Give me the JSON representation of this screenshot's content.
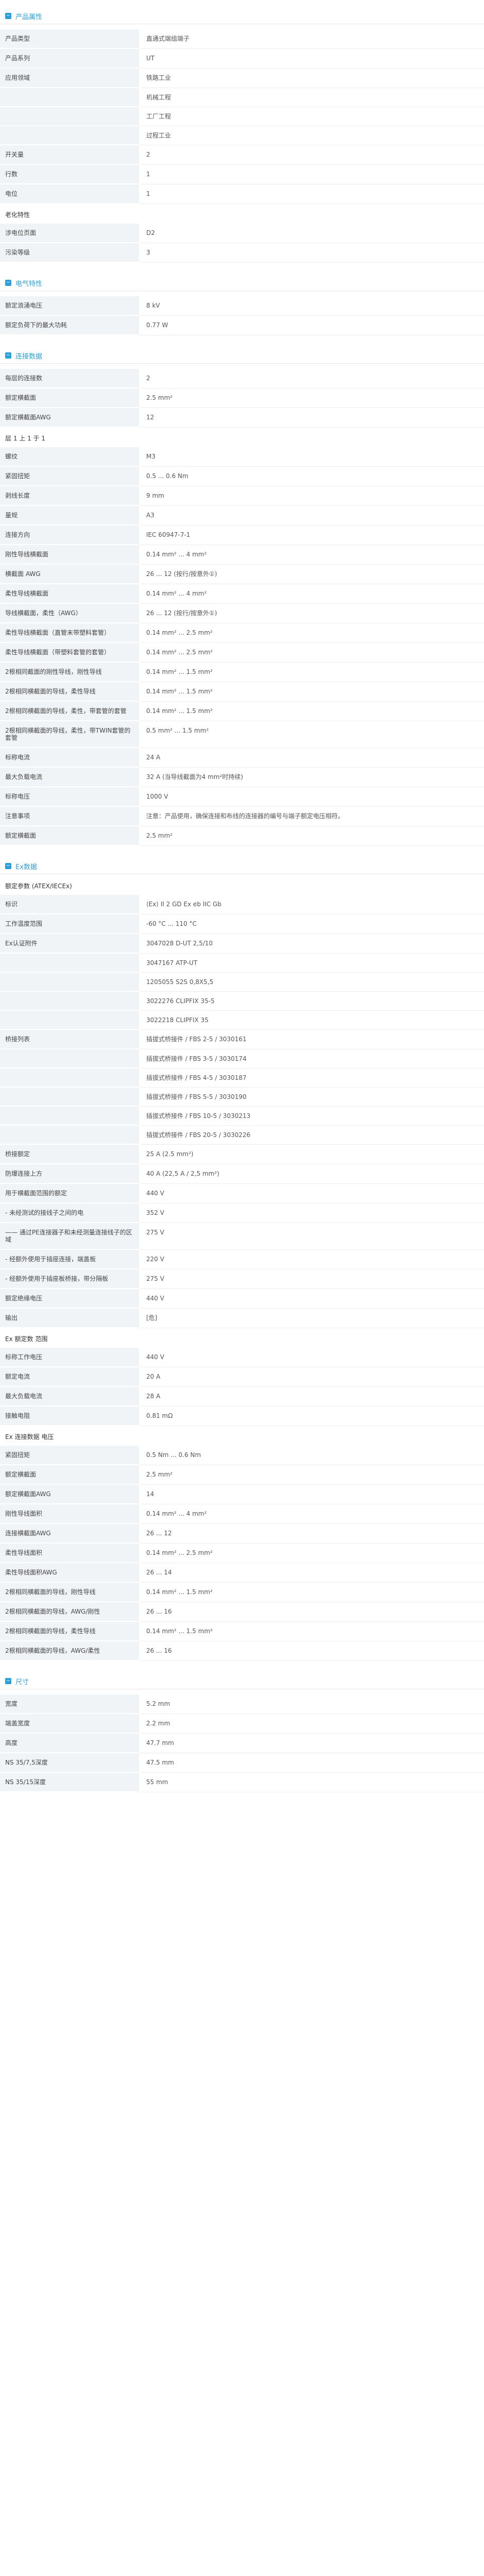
{
  "sections": [
    {
      "title": "产品属性",
      "groups": [
        {
          "rows": [
            {
              "key": "产品类型",
              "values": [
                "直通式端组端子"
              ]
            },
            {
              "key": "产品系列",
              "values": [
                "UT"
              ]
            },
            {
              "key": "应用领域",
              "values": [
                "铁路工业",
                "机械工程",
                "工厂工程",
                "过程工业"
              ]
            },
            {
              "key": "开关量",
              "values": [
                "2"
              ]
            },
            {
              "key": "行数",
              "values": [
                "1"
              ]
            },
            {
              "key": "电位",
              "values": [
                "1"
              ]
            }
          ]
        },
        {
          "subtitle": "老化特性",
          "rows": [
            {
              "key": "涉电位页面",
              "values": [
                "D2"
              ]
            },
            {
              "key": "污染等级",
              "values": [
                "3"
              ]
            }
          ]
        }
      ]
    },
    {
      "title": "电气特性",
      "groups": [
        {
          "rows": [
            {
              "key": "额定浪涌电压",
              "values": [
                "8 kV"
              ]
            },
            {
              "key": "额定负荷下的最大功耗",
              "values": [
                "0.77 W"
              ]
            }
          ]
        }
      ]
    },
    {
      "title": "连接数据",
      "groups": [
        {
          "rows": [
            {
              "key": "每层的连接数",
              "values": [
                "2"
              ]
            },
            {
              "key": "额定横截面",
              "values": [
                "2.5 mm²"
              ]
            },
            {
              "key": "额定横截面AWG",
              "values": [
                "12"
              ]
            }
          ]
        },
        {
          "subtitle": "层 1 上 1 于 1",
          "rows": [
            {
              "key": "螺纹",
              "values": [
                "M3"
              ]
            },
            {
              "key": "紧固扭矩",
              "values": [
                "0.5 ... 0.6 Nm"
              ]
            },
            {
              "key": "剥线长度",
              "values": [
                "9 mm"
              ]
            },
            {
              "key": "量规",
              "values": [
                "A3"
              ]
            },
            {
              "key": "连接方向",
              "values": [
                "IEC 60947-7-1"
              ]
            },
            {
              "key": "刚性导线横截面",
              "values": [
                "0.14 mm² ... 4 mm²"
              ]
            },
            {
              "key": "横截面 AWG",
              "values": [
                "26 ... 12 (按行/按意外①)"
              ]
            },
            {
              "key": "柔性导线横截面",
              "values": [
                "0.14 mm² ... 4 mm²"
              ]
            },
            {
              "key": "导线横截面，柔性（AWG）",
              "values": [
                "26 ... 12 (按行/按意外①)"
              ]
            },
            {
              "key": "柔性导线横截面（直管末带塑料套管）",
              "values": [
                "0.14 mm² ... 2.5 mm²"
              ]
            },
            {
              "key": "柔性导线横截面（带塑料套管的套管）",
              "values": [
                "0.14 mm² ... 2.5 mm²"
              ]
            },
            {
              "key": "2根相同截面的刚性导线，刚性导线",
              "values": [
                "0.14 mm² ... 1.5 mm²"
              ]
            },
            {
              "key": "2根相同横截面的导线，柔性导线",
              "values": [
                "0.14 mm² ... 1.5 mm²"
              ]
            },
            {
              "key": "2根相同横截面的导线，柔性，带套管的套管",
              "values": [
                "0.14 mm² ... 1.5 mm²"
              ]
            },
            {
              "key": "2根相同横截面的导线，柔性，带TWIN套管的套管",
              "values": [
                "0.5 mm² ... 1.5 mm²"
              ]
            },
            {
              "key": "标称电流",
              "values": [
                "24 A"
              ]
            },
            {
              "key": "最大负载电流",
              "values": [
                "32 A (当导线截面为4 mm²时持续)"
              ]
            },
            {
              "key": "标称电压",
              "values": [
                "1000 V"
              ]
            },
            {
              "key": "注意事项",
              "values": [
                "注意：产品使用，确保连接和布线的连接器的编号与端子额定电压相符。"
              ]
            },
            {
              "key": "额定横截面",
              "values": [
                "2.5 mm²"
              ]
            }
          ]
        }
      ]
    },
    {
      "title": "Ex数据",
      "groups": [
        {
          "subtitle": "额定参数 (ATEX/IECEx)",
          "rows": [
            {
              "key": "标识",
              "values": [
                "⟨Ex⟩ II 2 GD Ex eb IIC Gb"
              ]
            },
            {
              "key": "工作温度范围",
              "values": [
                "-60 °C ... 110 °C"
              ]
            },
            {
              "key": "Ex认证附件",
              "values": [
                "3047028 D-UT 2,5/10",
                "3047167 ATP-UT",
                "1205055 S2S 0,8X5,5",
                "3022276 CLIPFIX 35-5",
                "3022218 CLIPFIX 35"
              ]
            },
            {
              "key": "桥接列表",
              "values": [
                "插拔式桥接件 / FBS 2-5 / 3030161",
                "插拔式桥接件 / FBS 3-5 / 3030174",
                "插拔式桥接件 / FBS 4-5 / 3030187",
                "插拔式桥接件 / FBS 5-5 / 3030190",
                "插拔式桥接件 / FBS 10-5 / 3030213",
                "插拔式桥接件 / FBS 20-5 / 3030226"
              ]
            },
            {
              "key": "桥接额定",
              "values": [
                "25 A (2.5 mm²)"
              ]
            },
            {
              "key": "防爆连接上方",
              "values": [
                "40 A (22,5 A / 2,5 mm²)"
              ]
            },
            {
              "key": "用于横截面范围的额定",
              "values": [
                "440 V"
              ]
            },
            {
              "key": "- 未经测试的接线子之间的电",
              "values": [
                "352 V"
              ]
            },
            {
              "key": "—— 通过PE连接器子和未经测量连接线子的区域",
              "values": [
                "275 V"
              ]
            },
            {
              "key": "- 经额外使用于插座连接，端盖板",
              "values": [
                "220 V"
              ]
            },
            {
              "key": "- 经额外使用于插座板桥接，带分隔板",
              "values": [
                "275 V"
              ]
            },
            {
              "key": "额定绝缘电压",
              "values": [
                "440 V"
              ]
            },
            {
              "key": "输出",
              "values": [
                "[危]"
              ]
            }
          ]
        },
        {
          "subtitle": "Ex 额定数 范围",
          "rows": [
            {
              "key": "标称工作电压",
              "values": [
                "440 V"
              ]
            },
            {
              "key": "额定电流",
              "values": [
                "20 A"
              ]
            },
            {
              "key": "最大负载电流",
              "values": [
                "28 A"
              ]
            },
            {
              "key": "接触电阻",
              "values": [
                "0.81 mΩ"
              ]
            }
          ]
        },
        {
          "subtitle": "Ex 连接数据 电压",
          "rows": [
            {
              "key": "紧固扭矩",
              "values": [
                "0.5 Nm ... 0.6 Nm"
              ]
            },
            {
              "key": "额定横截面",
              "values": [
                "2.5 mm²"
              ]
            },
            {
              "key": "额定横截面AWG",
              "values": [
                "14"
              ]
            },
            {
              "key": "刚性导线面积",
              "values": [
                "0.14 mm² ... 4 mm²"
              ]
            },
            {
              "key": "连接横截面AWG",
              "values": [
                "26 ... 12"
              ]
            },
            {
              "key": "柔性导线面积",
              "values": [
                "0.14 mm² ... 2.5 mm²"
              ]
            },
            {
              "key": "柔性导线面积AWG",
              "values": [
                "26 ... 14"
              ]
            },
            {
              "key": "2根相同横截面的导线，刚性导线",
              "values": [
                "0.14 mm² ... 1.5 mm²"
              ]
            },
            {
              "key": "2根相同横截面的导线，AWG/刚性",
              "values": [
                "26 ... 16"
              ]
            },
            {
              "key": "2根相同横截面的导线，柔性导线",
              "values": [
                "0.14 mm² ... 1.5 mm²"
              ]
            },
            {
              "key": "2根相同横截面的导线，AWG/柔性",
              "values": [
                "26 ... 16"
              ]
            }
          ]
        }
      ]
    },
    {
      "title": "尺寸",
      "groups": [
        {
          "rows": [
            {
              "key": "宽度",
              "values": [
                "5.2 mm"
              ]
            },
            {
              "key": "端盖宽度",
              "values": [
                "2.2 mm"
              ]
            },
            {
              "key": "高度",
              "values": [
                "47.7 mm"
              ]
            },
            {
              "key": "NS 35/7,5深度",
              "values": [
                "47.5 mm"
              ]
            },
            {
              "key": "NS 35/15深度",
              "values": [
                "55 mm"
              ]
            }
          ]
        }
      ]
    }
  ]
}
